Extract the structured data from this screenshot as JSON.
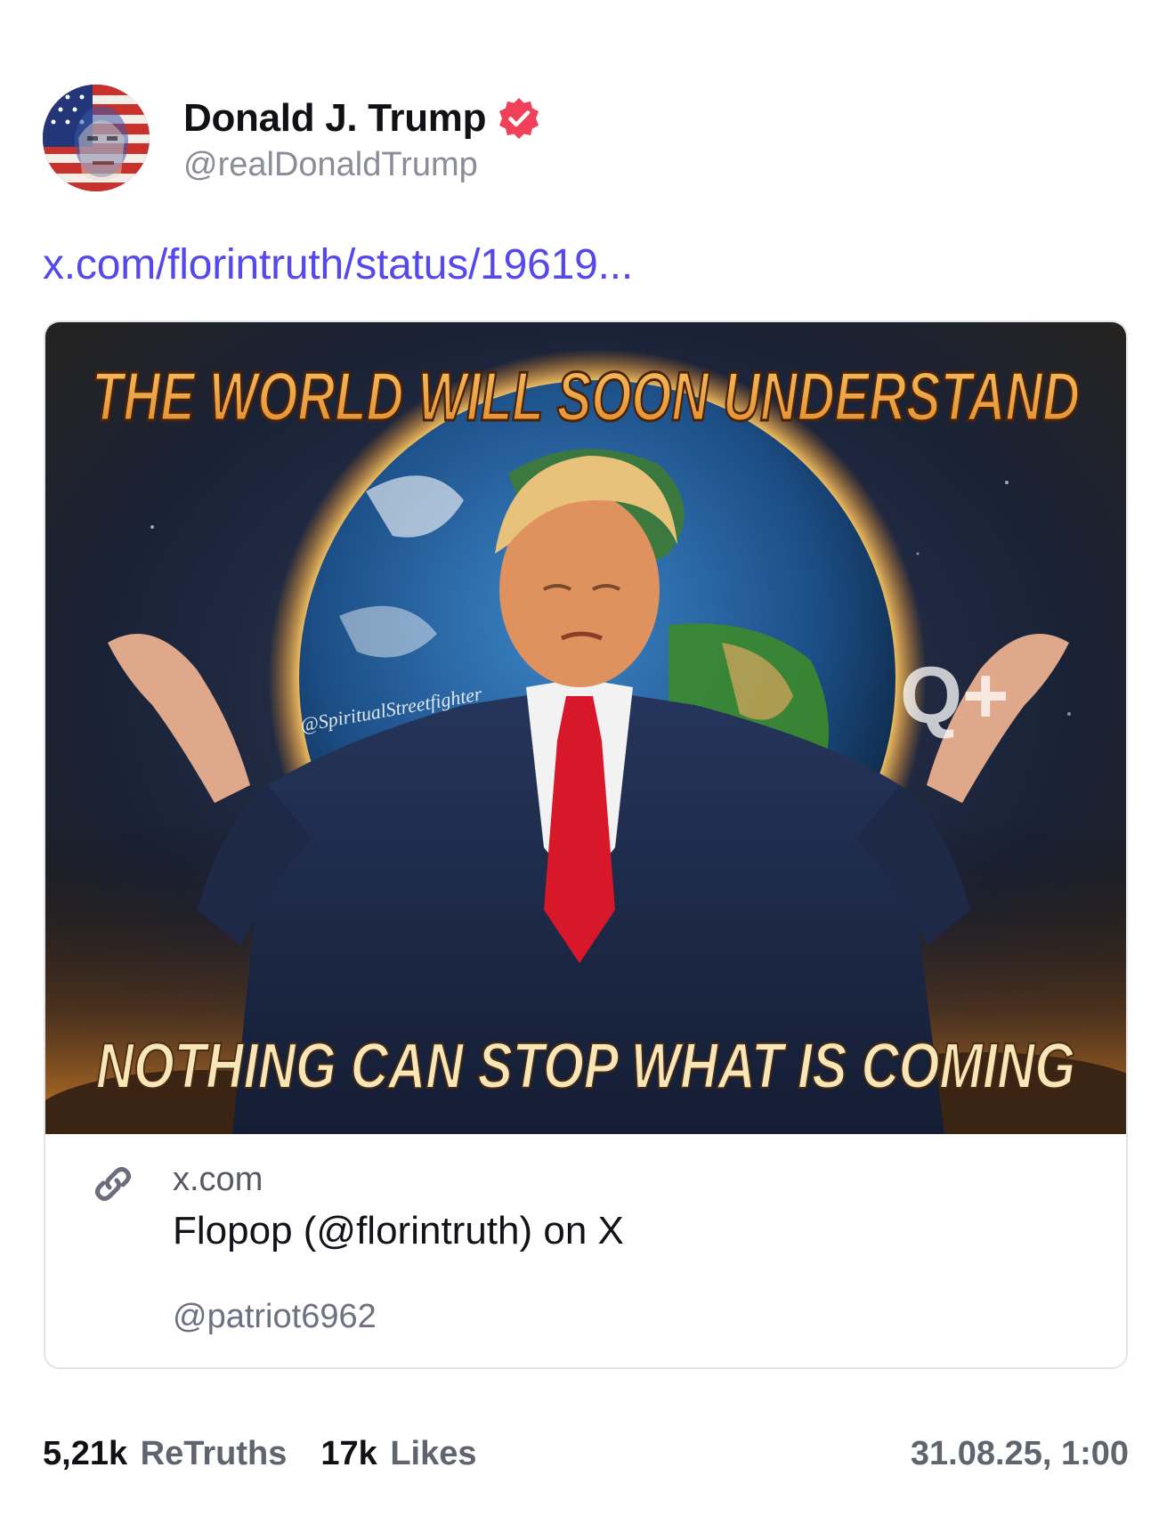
{
  "author": {
    "display_name": "Donald J. Trump",
    "handle": "@realDonaldTrump",
    "verified_icon": "verified-badge-icon",
    "verified_color": "#f0405a",
    "avatar": "flag-portrait-avatar"
  },
  "post": {
    "link_text": "x.com/florintruth/status/19619...",
    "link_color": "#5448ee"
  },
  "card": {
    "image": {
      "top_text": "THE WORLD WILL SOON UNDERSTAND",
      "bottom_text": "NOTHING CAN STOP WHAT IS COMING",
      "watermark": "@SpiritualStreetfighter",
      "symbol": "Q+"
    },
    "link_icon": "link-icon",
    "domain": "x.com",
    "title": "Flopop (@florintruth) on X",
    "author": "@patriot6962"
  },
  "stats": {
    "retruths_count": "5,21k",
    "retruths_label": "ReTruths",
    "likes_count": "17k",
    "likes_label": "Likes",
    "timestamp": "31.08.25, 1:00"
  }
}
